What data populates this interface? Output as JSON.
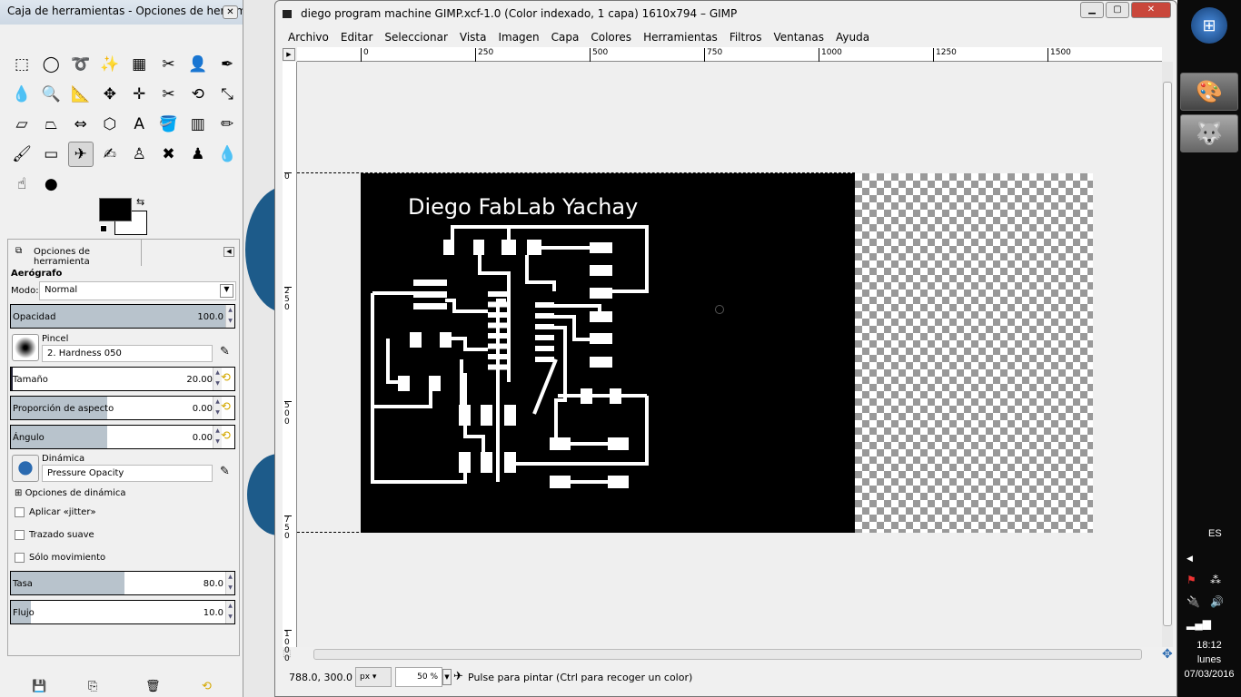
{
  "toolbox": {
    "title": "Caja de herramientas - Opciones de herram...",
    "tools": [
      {
        "name": "rect-select",
        "glyph": "⬚"
      },
      {
        "name": "ellipse-select",
        "glyph": "◯"
      },
      {
        "name": "free-select",
        "glyph": "➰"
      },
      {
        "name": "fuzzy-select",
        "glyph": "✨"
      },
      {
        "name": "select-by-color",
        "glyph": "▦"
      },
      {
        "name": "scissors",
        "glyph": "✂"
      },
      {
        "name": "foreground-select",
        "glyph": "👤"
      },
      {
        "name": "paths",
        "glyph": "✒"
      },
      {
        "name": "color-picker",
        "glyph": "💧"
      },
      {
        "name": "zoom",
        "glyph": "🔍"
      },
      {
        "name": "measure",
        "glyph": "📐"
      },
      {
        "name": "move",
        "glyph": "✥"
      },
      {
        "name": "align",
        "glyph": "✛"
      },
      {
        "name": "crop",
        "glyph": "✂"
      },
      {
        "name": "rotate",
        "glyph": "⟲"
      },
      {
        "name": "scale",
        "glyph": "⤡"
      },
      {
        "name": "shear",
        "glyph": "▱"
      },
      {
        "name": "perspective",
        "glyph": "⏢"
      },
      {
        "name": "flip",
        "glyph": "⇔"
      },
      {
        "name": "cage-transform",
        "glyph": "⬡"
      },
      {
        "name": "text",
        "glyph": "A"
      },
      {
        "name": "bucket-fill",
        "glyph": "🪣"
      },
      {
        "name": "blend",
        "glyph": "▥"
      },
      {
        "name": "pencil",
        "glyph": "✏"
      },
      {
        "name": "paintbrush",
        "glyph": "🖌"
      },
      {
        "name": "eraser",
        "glyph": "▭"
      },
      {
        "name": "airbrush",
        "glyph": "✈"
      },
      {
        "name": "ink",
        "glyph": "✍"
      },
      {
        "name": "clone",
        "glyph": "♙"
      },
      {
        "name": "heal",
        "glyph": "✖"
      },
      {
        "name": "perspective-clone",
        "glyph": "♟"
      },
      {
        "name": "blur-sharpen",
        "glyph": "💧"
      },
      {
        "name": "smudge",
        "glyph": "☝"
      },
      {
        "name": "dodge-burn",
        "glyph": "●"
      }
    ],
    "selected_tool": "airbrush",
    "fg_color": "#000000",
    "bg_color": "#ffffff",
    "tab_label": "Opciones de herramienta",
    "options": {
      "tool_name": "Aerógrafo",
      "mode_label": "Modo:",
      "mode_value": "Normal",
      "opacity": {
        "label": "Opacidad",
        "value": "100.0",
        "fraction": 1.0
      },
      "brush_label": "Pincel",
      "brush_value": "2. Hardness 050",
      "size": {
        "label": "Tamaño",
        "value": "20.00",
        "fraction": 0.01
      },
      "aspect": {
        "label": "Proporción de aspecto",
        "value": "0.00",
        "fraction": 0.43
      },
      "angle": {
        "label": "Ángulo",
        "value": "0.00",
        "fraction": 0.43
      },
      "dynamics_label": "Dinámica",
      "dynamics_value": "Pressure Opacity",
      "dynamics_options": "Opciones de dinámica",
      "jitter": "Aplicar «jitter»",
      "smooth": "Trazado suave",
      "motion_only": "Sólo movimiento",
      "rate": {
        "label": "Tasa",
        "value": "80.0",
        "fraction": 0.51
      },
      "flow": {
        "label": "Flujo",
        "value": "10.0",
        "fraction": 0.09
      }
    }
  },
  "image_window": {
    "title": "diego program machine GIMP.xcf-1.0 (Color indexado, 1 capa) 1610x794 – GIMP",
    "menu": [
      "Archivo",
      "Editar",
      "Seleccionar",
      "Vista",
      "Imagen",
      "Capa",
      "Colores",
      "Herramientas",
      "Filtros",
      "Ventanas",
      "Ayuda"
    ],
    "ruler_h": [
      "0",
      "250",
      "500",
      "750",
      "1000",
      "1250",
      "1500"
    ],
    "ruler_v": [
      "0",
      "250",
      "500",
      "750",
      "1000"
    ],
    "canvas_text": "Diego FabLab Yachay",
    "status": {
      "coords": "788.0, 300.0",
      "unit": "px",
      "zoom": "50 %",
      "message": "Pulse para pintar (Ctrl para recoger un color)"
    }
  },
  "taskbar": {
    "language": "ES",
    "time": "18:12",
    "day": "lunes",
    "date": "07/03/2016"
  }
}
